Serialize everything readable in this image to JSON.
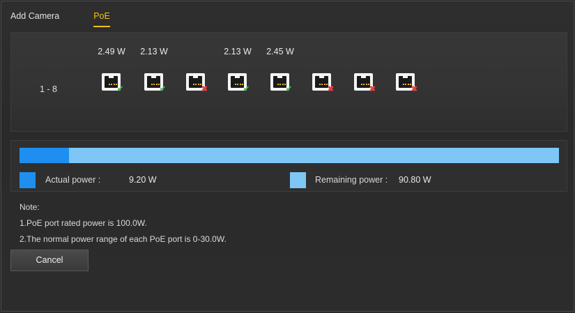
{
  "tabs": [
    {
      "label": "Add Camera",
      "active": false
    },
    {
      "label": "PoE",
      "active": true
    }
  ],
  "ports_panel": {
    "range_label": "1 - 8",
    "ports": [
      {
        "watt": "2.49 W",
        "status": "connected"
      },
      {
        "watt": "2.13 W",
        "status": "connected"
      },
      {
        "watt": "",
        "status": "disconnected"
      },
      {
        "watt": "2.13 W",
        "status": "connected"
      },
      {
        "watt": "2.45 W",
        "status": "connected"
      },
      {
        "watt": "",
        "status": "disconnected"
      },
      {
        "watt": "",
        "status": "disconnected"
      },
      {
        "watt": "",
        "status": "disconnected"
      }
    ]
  },
  "power": {
    "actual_label": "Actual power :",
    "actual_value": "9.20 W",
    "remaining_label": "Remaining power :",
    "remaining_value": "90.80 W",
    "used_fraction": 0.092,
    "actual_color": "#1e8ff0",
    "remaining_color": "#7ec6f5"
  },
  "notes": {
    "title": "Note:",
    "line1": "1.PoE port rated power is 100.0W.",
    "line2": "2.The normal power range of each PoE port is 0-30.0W."
  },
  "buttons": {
    "cancel": "Cancel"
  },
  "colors": {
    "accent": "#f2c21b",
    "ok": "#34c24a",
    "error": "#ff3333"
  }
}
